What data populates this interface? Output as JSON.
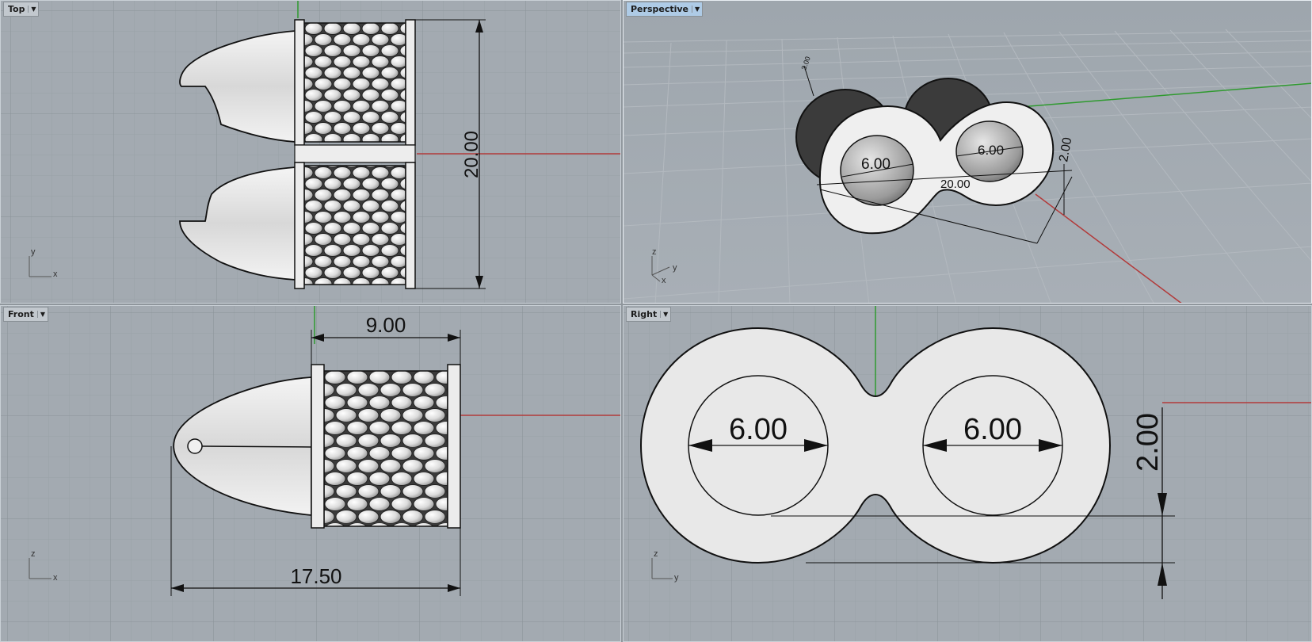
{
  "viewports": {
    "top": {
      "label": "Top",
      "dim_height": "20.00",
      "axis": {
        "a": "y",
        "b": "x"
      }
    },
    "perspective": {
      "label": "Perspective",
      "dim_hole_left": "6.00",
      "dim_hole_right": "6.00",
      "dim_width": "20.00",
      "dim_height": "2.00",
      "dim_small": "3.00",
      "axis": {
        "a": "z",
        "b": "y",
        "c": "x"
      }
    },
    "front": {
      "label": "Front",
      "dim_width": "9.00",
      "dim_length": "17.50",
      "axis": {
        "a": "z",
        "b": "x"
      }
    },
    "right": {
      "label": "Right",
      "dim_hole_left": "6.00",
      "dim_hole_right": "6.00",
      "dim_height": "2.00",
      "axis": {
        "a": "z",
        "b": "y"
      }
    }
  },
  "colors": {
    "background": "#a3aab1",
    "grid_minor": "#9aa1a8",
    "grid_major": "#8c939a",
    "x_axis": "#b23a3a",
    "y_axis": "#2f9a2f",
    "active_tab": "#aecbe6"
  },
  "icons": {
    "dropdown": "dropdown-arrow-icon"
  }
}
